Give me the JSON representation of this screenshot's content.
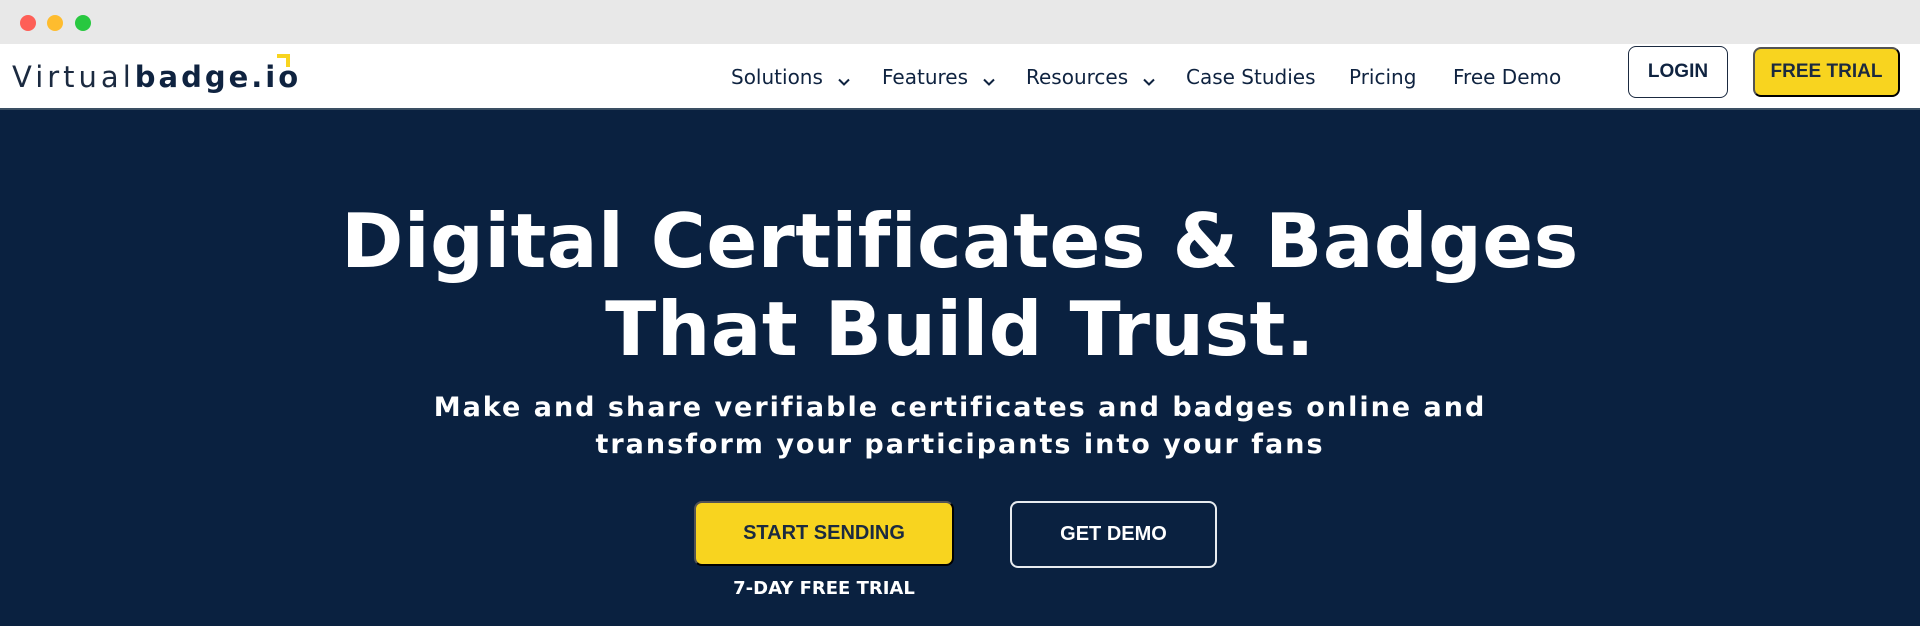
{
  "window": {
    "controls": [
      "close",
      "minimize",
      "maximize"
    ]
  },
  "brand": {
    "logo_light": "Virtual",
    "logo_bold": "badge.io",
    "accent_color": "#f8d41f",
    "navy_color": "#0a2140"
  },
  "nav": {
    "items": [
      {
        "label": "Solutions",
        "has_dropdown": true
      },
      {
        "label": "Features",
        "has_dropdown": true
      },
      {
        "label": "Resources",
        "has_dropdown": true
      },
      {
        "label": "Case Studies",
        "has_dropdown": false
      },
      {
        "label": "Pricing",
        "has_dropdown": false
      },
      {
        "label": "Free Demo",
        "has_dropdown": false
      }
    ],
    "login_label": "LOGIN",
    "free_trial_label": "FREE TRIAL"
  },
  "hero": {
    "title_line1": "Digital Certificates & Badges",
    "title_line2": "That Build Trust.",
    "subtitle_line1": "Make and share verifiable certificates and badges online and",
    "subtitle_line2": "transform your participants into your fans",
    "primary_cta": "START SENDING",
    "secondary_cta": "GET DEMO",
    "trial_note": "7-DAY FREE TRIAL"
  }
}
